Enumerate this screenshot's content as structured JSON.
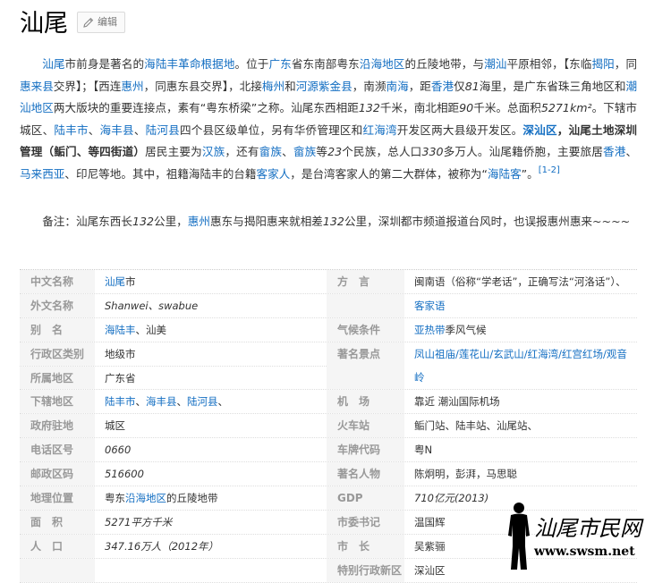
{
  "header": {
    "title": "汕尾",
    "edit_label": "编辑"
  },
  "intro": {
    "p1": [
      {
        "t": "汕尾",
        "l": true
      },
      {
        "t": "市前身是著名的"
      },
      {
        "t": "海陆丰革命根据地",
        "l": true
      },
      {
        "t": "。位于"
      },
      {
        "t": "广东",
        "l": true
      },
      {
        "t": "省东南部粤东"
      },
      {
        "t": "沿海地区",
        "l": true
      },
      {
        "t": "的丘陵地带，与"
      },
      {
        "t": "潮汕",
        "l": true
      },
      {
        "t": "平原相邻，【东临"
      },
      {
        "t": "揭阳",
        "l": true
      },
      {
        "t": "，同"
      },
      {
        "t": "惠来县",
        "l": true
      },
      {
        "t": "交界】；【西连"
      },
      {
        "t": "惠州",
        "l": true
      },
      {
        "t": "，同惠东县交界】，北接"
      },
      {
        "t": "梅州",
        "l": true
      },
      {
        "t": "和"
      },
      {
        "t": "河源",
        "l": true
      },
      {
        "t": "紫金县",
        "l": true
      },
      {
        "t": "，南濒"
      },
      {
        "t": "南海",
        "l": true
      },
      {
        "t": "，距"
      },
      {
        "t": "香港",
        "l": true
      },
      {
        "t": "仅"
      },
      {
        "t": "81",
        "i": true
      },
      {
        "t": "海里，是广东省珠三角地区和"
      },
      {
        "t": "潮汕地区",
        "l": true
      },
      {
        "t": "两大版块的重要连接点，素有“粤东桥梁”之称。汕尾东西相距"
      },
      {
        "t": "132",
        "i": true
      },
      {
        "t": "千米，南北相距"
      },
      {
        "t": "90",
        "i": true
      },
      {
        "t": "千米。总面积"
      },
      {
        "t": "5271km²",
        "i": true
      },
      {
        "t": "。下辖市城区、"
      },
      {
        "t": "陆丰市",
        "l": true
      },
      {
        "t": "、"
      },
      {
        "t": "海丰县",
        "l": true
      },
      {
        "t": "、"
      },
      {
        "t": "陆河县",
        "l": true
      },
      {
        "t": "四个县区级单位，另有华侨管理区和"
      },
      {
        "t": "红海湾",
        "l": true
      },
      {
        "t": "开发区两大县级开发区。"
      },
      {
        "t": "深汕区",
        "l": true,
        "b": true
      },
      {
        "t": "，汕尾土地深圳管理（鲘门、等四街道）",
        "b": true
      },
      {
        "t": "居民主要为"
      },
      {
        "t": "汉族",
        "l": true
      },
      {
        "t": "，还有"
      },
      {
        "t": "畲族",
        "l": true
      },
      {
        "t": "、"
      },
      {
        "t": "畲族",
        "l": true
      },
      {
        "t": "等"
      },
      {
        "t": "23",
        "i": true
      },
      {
        "t": "个民族，总人口"
      },
      {
        "t": "330",
        "i": true
      },
      {
        "t": "多万人。汕尾籍侨胞，主要旅居"
      },
      {
        "t": "香港",
        "l": true
      },
      {
        "t": "、"
      },
      {
        "t": "马来西亚",
        "l": true
      },
      {
        "t": "、印尼等地。其中，祖籍海陆丰的台籍"
      },
      {
        "t": "客家人",
        "l": true
      },
      {
        "t": "，是台湾客家人的第二大群体，被称为“"
      },
      {
        "t": "海陆客",
        "l": true
      },
      {
        "t": "”。"
      },
      {
        "t": "[1-2]",
        "sup": true
      }
    ],
    "note": [
      {
        "t": "备注：汕尾东西长"
      },
      {
        "t": "132",
        "i": true
      },
      {
        "t": "公里，"
      },
      {
        "t": "惠州",
        "l": true
      },
      {
        "t": "惠东与揭阳惠来就相差"
      },
      {
        "t": "132",
        "i": true
      },
      {
        "t": "公里，深圳都市频道报道台风时，也误报惠州惠来~~~~"
      }
    ]
  },
  "infobox": [
    {
      "ln": "中文名称",
      "lv": [
        {
          "t": "汕尾",
          "l": true
        },
        {
          "t": "市"
        }
      ],
      "rn": "方　言",
      "rv": [
        {
          "t": "闽南语（俗称“学老话”，正确写法“河洛话”）、"
        }
      ]
    },
    {
      "ln": "外文名称",
      "lv": [
        {
          "t": "Shanwei、swabue",
          "i": true
        }
      ],
      "rn": "",
      "rv": [
        {
          "t": "客家语",
          "l": true
        }
      ]
    },
    {
      "ln": "别　名",
      "lv": [
        {
          "t": "海陆丰",
          "l": true
        },
        {
          "t": "、汕美"
        }
      ],
      "rn": "气候条件",
      "rv": [
        {
          "t": "亚热带",
          "l": true
        },
        {
          "t": "季风气候"
        }
      ]
    },
    {
      "ln": "行政区类别",
      "lv": [
        {
          "t": "地级市"
        }
      ],
      "rn": "著名景点",
      "rv": [
        {
          "t": "凤山祖庙/莲花山/玄武山/红海湾/红宫红场/观音岭",
          "l": true
        }
      ],
      "tall": true
    },
    {
      "ln": "所属地区",
      "lv": [
        {
          "t": "广东省"
        }
      ],
      "rn": "",
      "rv": [],
      "merge": true
    },
    {
      "ln": "下辖地区",
      "lv": [
        {
          "t": "陆丰市",
          "l": true
        },
        {
          "t": "、"
        },
        {
          "t": "海丰县",
          "l": true
        },
        {
          "t": "、"
        },
        {
          "t": "陆河县",
          "l": true
        },
        {
          "t": "、"
        }
      ],
      "rn": "机　场",
      "rv": [
        {
          "t": "靠近 潮汕国际机场"
        }
      ]
    },
    {
      "ln": "政府驻地",
      "lv": [
        {
          "t": "城区"
        }
      ],
      "rn": "火车站",
      "rv": [
        {
          "t": "鲘门站、陆丰站、汕尾站、"
        }
      ]
    },
    {
      "ln": "电话区号",
      "lv": [
        {
          "t": "0660",
          "i": true
        }
      ],
      "rn": "车牌代码",
      "rv": [
        {
          "t": "粤N"
        }
      ]
    },
    {
      "ln": "邮政区码",
      "lv": [
        {
          "t": "516600",
          "i": true
        }
      ],
      "rn": "著名人物",
      "rv": [
        {
          "t": "陈炯明，彭湃，马思聪"
        }
      ]
    },
    {
      "ln": "地理位置",
      "lv": [
        {
          "t": "粤东"
        },
        {
          "t": "沿海地区",
          "l": true
        },
        {
          "t": "的丘陵地带"
        }
      ],
      "rn": "GDP",
      "rv": [
        {
          "t": "710亿元(2013)",
          "i": true
        }
      ]
    },
    {
      "ln": "面　积",
      "lv": [
        {
          "t": "5271平方千米",
          "i": true
        }
      ],
      "rn": "市委书记",
      "rv": [
        {
          "t": "温国辉"
        }
      ]
    },
    {
      "ln": "人　口",
      "lv": [
        {
          "t": "347.16万人（2012年）",
          "i": true
        }
      ],
      "rn": "市　长",
      "rv": [
        {
          "t": "吴紫骊"
        }
      ]
    },
    {
      "ln": "",
      "lv": [],
      "rn": "特别行政新区",
      "rv": [
        {
          "t": "深汕区"
        }
      ]
    }
  ],
  "watermark": {
    "title": "汕尾市民网",
    "url": "www.swsm.net"
  }
}
